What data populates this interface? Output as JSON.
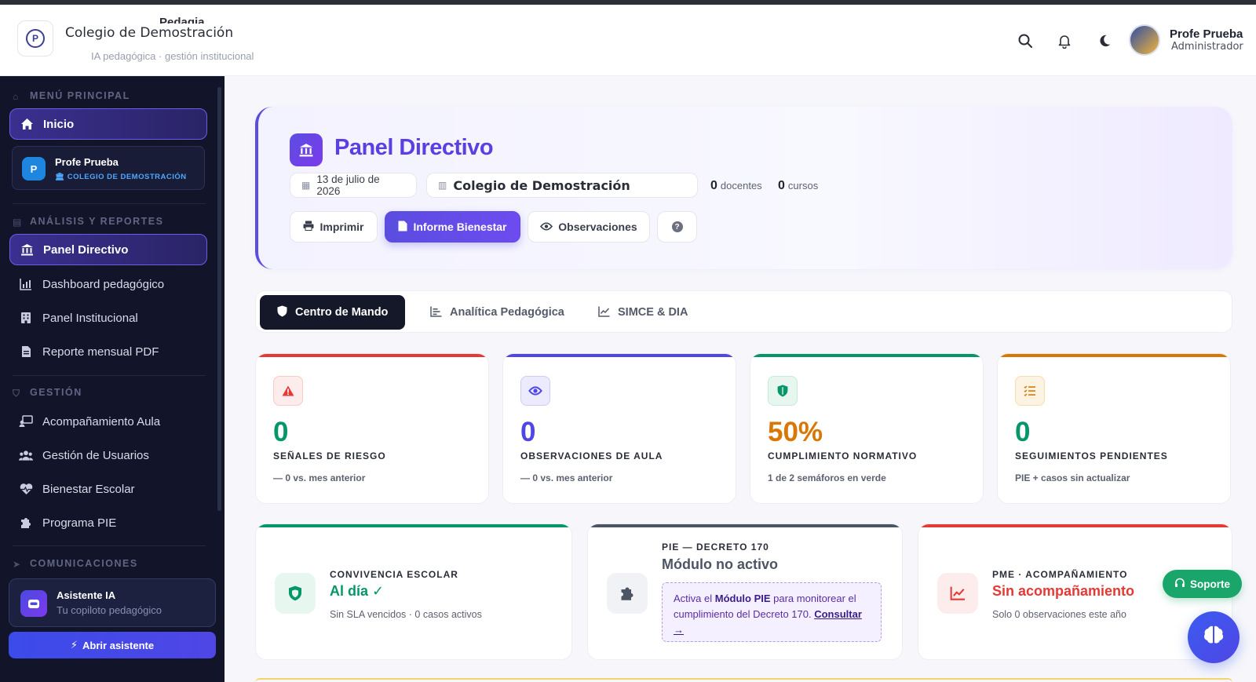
{
  "header": {
    "brand_top": "Pedagia",
    "school_name": "Colegio de Demostración",
    "tagline": "IA pedagógica · gestión institucional",
    "logo_letter": "P",
    "icons": [
      "search-icon",
      "bell-icon",
      "moon-icon"
    ],
    "user": {
      "name": "Profe Prueba",
      "role": "Administrador"
    }
  },
  "sidebar": {
    "sections": [
      {
        "title": "MENÚ PRINCIPAL",
        "icon": "home-icon"
      },
      {
        "title": "ANÁLISIS Y REPORTES",
        "icon": "chart-icon"
      },
      {
        "title": "GESTIÓN",
        "icon": "shield-icon"
      },
      {
        "title": "COMUNICACIONES",
        "icon": "send-icon"
      }
    ],
    "home": {
      "label": "Inicio",
      "icon": "home-icon"
    },
    "profile": {
      "initial": "P",
      "name": "Profe Prueba",
      "school": "COLEGIO DE DEMOSTRACIÓN"
    },
    "reports": [
      {
        "label": "Panel Directivo",
        "icon": "bank-icon",
        "active": true
      },
      {
        "label": "Dashboard pedagógico",
        "icon": "bar-chart-icon"
      },
      {
        "label": "Panel Institucional",
        "icon": "building-icon"
      },
      {
        "label": "Reporte mensual PDF",
        "icon": "file-icon"
      }
    ],
    "management": [
      {
        "label": "Acompañamiento Aula",
        "icon": "chalkboard-icon"
      },
      {
        "label": "Gestión de Usuarios",
        "icon": "users-icon"
      },
      {
        "label": "Bienestar Escolar",
        "icon": "heart-pulse-icon"
      },
      {
        "label": "Programa PIE",
        "icon": "puzzle-icon"
      }
    ],
    "assistant": {
      "title": "Asistente IA",
      "subtitle": "Tu copiloto pedagógico",
      "button": "Abrir asistente"
    }
  },
  "hero": {
    "title": "Panel Directivo",
    "date": "13 de julio de 2026",
    "school": "Colegio de Demostración",
    "teachers_count": "0",
    "teachers_label": "docentes",
    "courses_count": "0",
    "courses_label": "cursos",
    "buttons": {
      "print": "Imprimir",
      "report": "Informe Bienestar",
      "observations": "Observaciones",
      "help": "?"
    }
  },
  "tabs": [
    {
      "label": "Centro de Mando",
      "icon": "shield-icon",
      "active": true
    },
    {
      "label": "Analítica Pedagógica",
      "icon": "bars-icon"
    },
    {
      "label": "SIMCE & DIA",
      "icon": "line-chart-icon"
    }
  ],
  "kpis": [
    {
      "value": "0",
      "label": "SEÑALES DE RIESGO",
      "sub": "— 0 vs. mes anterior",
      "color": "#e53935",
      "icon": "warning-icon"
    },
    {
      "value": "0",
      "label": "OBSERVACIONES DE AULA",
      "sub": "— 0 vs. mes anterior",
      "color": "#4f46e5",
      "icon": "eye-icon"
    },
    {
      "value": "50%",
      "label": "CUMPLIMIENTO NORMATIVO",
      "sub": "1 de 2 semáforos en verde",
      "color": "#d97706",
      "icon": "shield-check-icon"
    },
    {
      "value": "0",
      "label": "SEGUIMIENTOS PENDIENTES",
      "sub": "PIE + casos sin actualizar",
      "color": "#059669",
      "icon": "list-check-icon"
    }
  ],
  "cards": {
    "convivencia": {
      "label": "CONVIVENCIA ESCOLAR",
      "value": "Al día ✓",
      "sub": "Sin SLA vencidos · 0 casos activos",
      "icon": "shield-icon"
    },
    "pie": {
      "label": "PIE — DECRETO 170",
      "value": "Módulo no activo",
      "note_pre": "Activa el ",
      "note_bold": "Módulo PIE",
      "note_mid": " para monitorear el cumplimiento del Decreto 170. ",
      "note_link": "Consultar →",
      "icon": "puzzle-icon"
    },
    "pme": {
      "label": "PME · ACOMPAÑAMIENTO",
      "value": "Sin acompañamiento",
      "sub": "Solo 0 observaciones este año",
      "icon": "trend-icon"
    }
  },
  "support": {
    "label": "Soporte"
  }
}
